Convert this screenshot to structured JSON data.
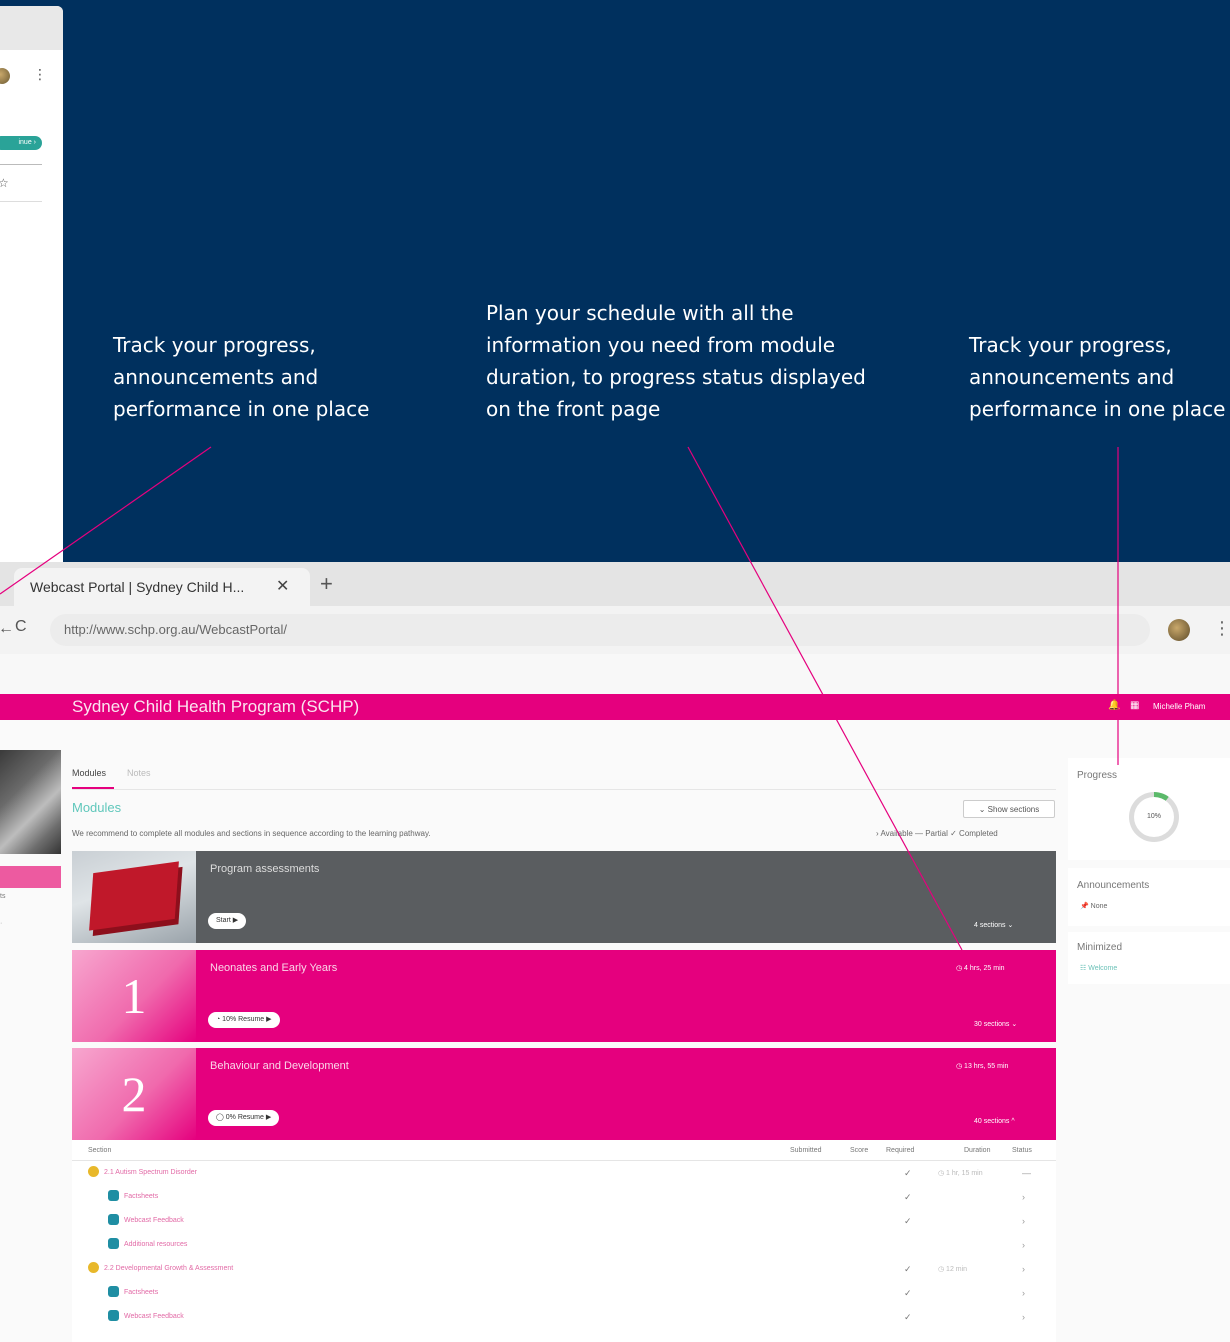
{
  "callouts": {
    "left": "Track your progress,\nannouncements and\nperformance in one place",
    "center": "Plan your schedule with all the\ninformation you need from module\nduration, to progress status displayed\non the front page",
    "right": "Track your progress,\nannouncements and\nperformance in one place"
  },
  "ghost_browser": {
    "pill_label": "inue ›",
    "icons": [
      "avatar-icon",
      "kebab-menu-icon",
      "star-icon"
    ]
  },
  "browser": {
    "tab_title": "Webcast Portal | Sydney Child H...",
    "tab_close": "✕",
    "new_tab": "+",
    "url": "http://www.schp.org.au/WebcastPortal/"
  },
  "app": {
    "title": "Sydney Child Health Program (SCHP)",
    "user_name": "Michelle Pham"
  },
  "sidebar": {
    "items": [
      "ts",
      "·"
    ]
  },
  "main": {
    "tabs": [
      {
        "label": "Modules",
        "active": true
      },
      {
        "label": "Notes",
        "active": false
      }
    ],
    "heading": "Modules",
    "description": "We recommend to complete all modules and sections in sequence according to the learning pathway.",
    "show_sections_label": "⌄  Show sections",
    "legend": "›  Available    —  Partial  ✓  Completed"
  },
  "modules": [
    {
      "title": "Program assessments",
      "button": "Start ▶",
      "duration": "",
      "sections": "4 sections  ⌄"
    },
    {
      "number": "1",
      "title": "Neonates and Early Years",
      "button": "◔ 10% Resume ▶",
      "duration": "◷  4 hrs, 25 min",
      "sections": "30 sections  ⌄"
    },
    {
      "number": "2",
      "title": "Behaviour and Development",
      "button": "◯ 0% Resume ▶",
      "duration": "◷  13 hrs, 55 min",
      "sections": "40 sections  ^"
    }
  ],
  "section_table": {
    "headers": {
      "section": "Section",
      "submitted": "Submitted",
      "score": "Score",
      "required": "Required",
      "duration": "Duration",
      "status": "Status"
    },
    "rows": [
      {
        "level": 0,
        "title": "2.1 Autism Spectrum Disorder",
        "required": "✓",
        "duration": "◷ 1 hr, 15 min",
        "status": "—"
      },
      {
        "level": 1,
        "title": "Factsheets",
        "required": "✓",
        "duration": "",
        "status": "›"
      },
      {
        "level": 1,
        "title": "Webcast Feedback",
        "required": "✓",
        "duration": "",
        "status": "›"
      },
      {
        "level": 1,
        "title": "Additional resources",
        "required": "",
        "duration": "",
        "status": "›"
      },
      {
        "level": 0,
        "title": "2.2 Developmental Growth & Assessment",
        "required": "✓",
        "duration": "◷ 12 min",
        "status": "›"
      },
      {
        "level": 1,
        "title": "Factsheets",
        "required": "✓",
        "duration": "",
        "status": "›"
      },
      {
        "level": 1,
        "title": "Webcast Feedback",
        "required": "✓",
        "duration": "",
        "status": "›"
      }
    ]
  },
  "right_panel": {
    "progress_label": "Progress",
    "progress_value": "10%",
    "progress_fraction": 0.1,
    "announcements_label": "Announcements",
    "announcement_item": "📌  None",
    "minimized_label": "Minimized",
    "minimized_item": "☷  Welcome"
  },
  "colors": {
    "background_navy": "#00305e",
    "brand_pink": "#e5007e",
    "teal_accent": "#5fc7bb",
    "card_gray": "#5a5d60",
    "callout_line": "#e5007e"
  }
}
